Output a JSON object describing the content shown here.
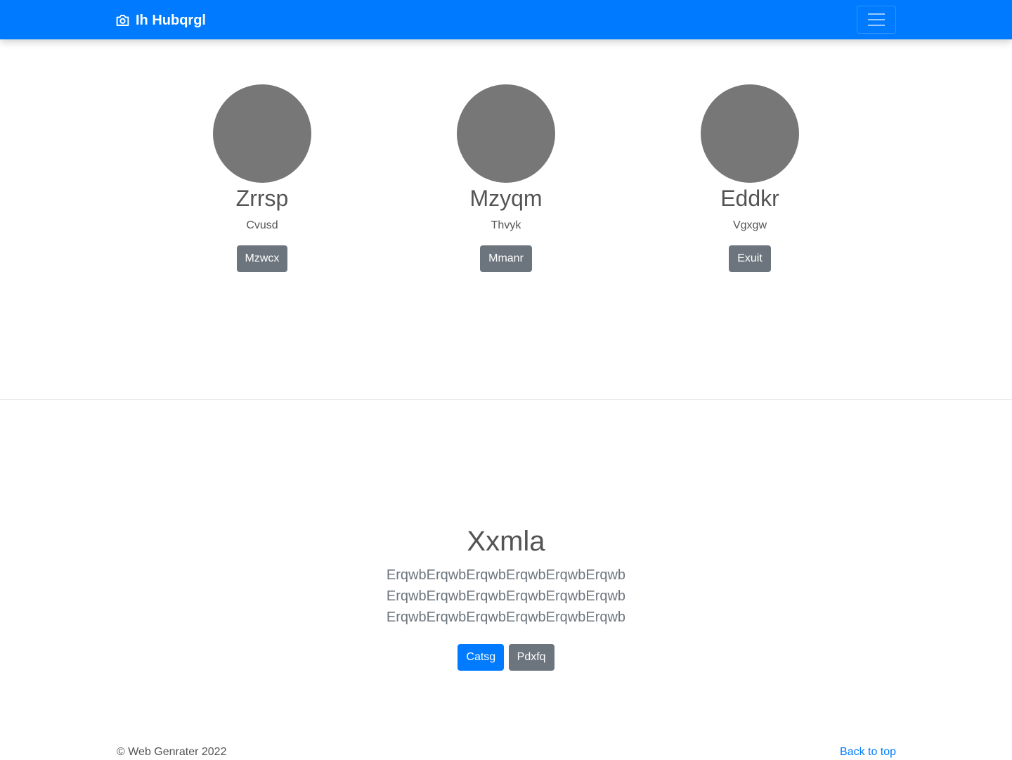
{
  "navbar": {
    "brand": "Ih Hubqrgl",
    "brand_icon": "camera-icon",
    "toggler_icon": "hamburger-menu-icon",
    "background": "#007bff"
  },
  "members": [
    {
      "name": "Zrrsp",
      "role": "Cvusd",
      "button": "Mzwcx"
    },
    {
      "name": "Mzyqm",
      "role": "Thvyk",
      "button": "Mmanr"
    },
    {
      "name": "Eddkr",
      "role": "Vgxgw",
      "button": "Exuit"
    }
  ],
  "hero": {
    "title": "Xxmla",
    "lines": [
      "ErqwbErqwbErqwbErqwbErqwbErqwb",
      "ErqwbErqwbErqwbErqwbErqwbErqwb",
      "ErqwbErqwbErqwbErqwbErqwbErqwb"
    ],
    "primary_button": "Catsg",
    "secondary_button": "Pdxfq"
  },
  "footer": {
    "copyright": "© Web Genrater 2022",
    "back_to_top": "Back to top"
  },
  "colors": {
    "primary": "#007bff",
    "secondary": "#6c757d",
    "avatar": "#777777"
  }
}
